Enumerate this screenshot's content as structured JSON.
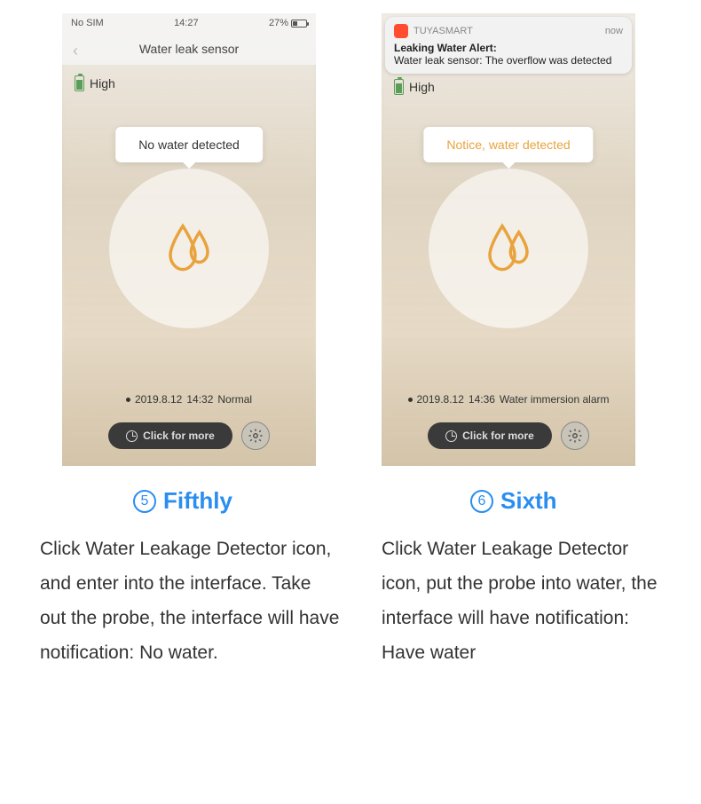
{
  "left": {
    "status_bar": {
      "carrier": "No SIM",
      "wifi": "wifi-icon",
      "time": "14:27",
      "battery_pct": "27%"
    },
    "title": "Water leak sensor",
    "battery_level": "High",
    "status_text": "No water detected",
    "log": {
      "date": "2019.8.12",
      "time": "14:32",
      "label": "Normal"
    },
    "click_more": "Click for more",
    "step_num": "5",
    "step_title": "Fifthly",
    "desc": "Click Water Leakage Detector icon, and enter into the interface. Take out the probe, the interface will have notification: No water."
  },
  "right": {
    "notification": {
      "app": "TUYASMART",
      "time": "now",
      "title": "Leaking Water Alert:",
      "body": "Water leak sensor: The overflow was detected"
    },
    "battery_level": "High",
    "status_text": "Notice, water detected",
    "log": {
      "date": "2019.8.12",
      "time": "14:36",
      "label": "Water immersion alarm"
    },
    "click_more": "Click for more",
    "step_num": "6",
    "step_title": "Sixth",
    "desc": "Click Water Leakage Detector icon, put the probe into water, the interface will have notification: Have water"
  }
}
